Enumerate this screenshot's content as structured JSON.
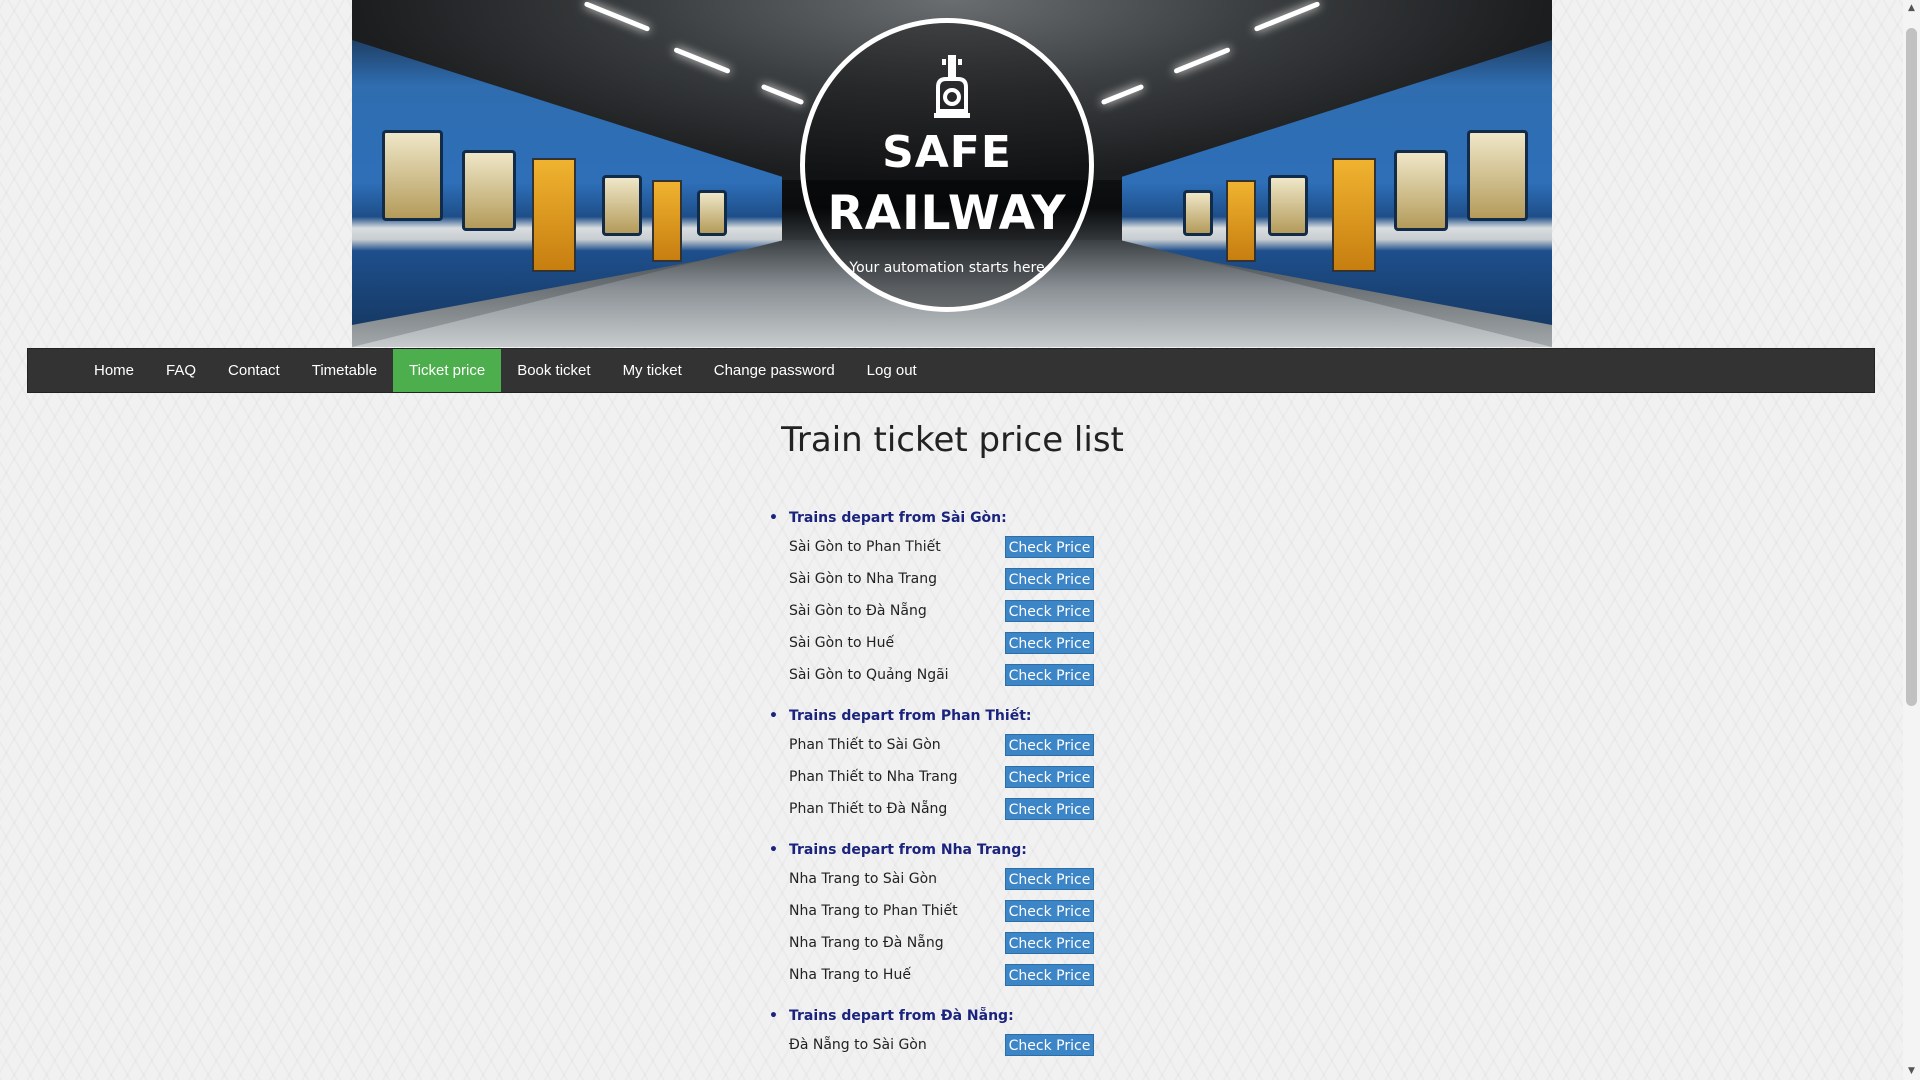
{
  "header": {
    "logo_line1": "SAFE",
    "logo_line2": "RAILWAY",
    "tagline": "Your automation starts here",
    "logo_icon": "train-icon"
  },
  "nav": {
    "items": [
      "Home",
      "FAQ",
      "Contact",
      "Timetable",
      "Ticket price",
      "Book ticket",
      "My ticket",
      "Change password",
      "Log out"
    ],
    "active": "Ticket price",
    "active_color": "#4cae4c",
    "background": "#333333"
  },
  "main": {
    "title": "Train ticket price list",
    "button_label": "Check Price",
    "button_color": "#3c85c7",
    "group_title_color": "#1a237e",
    "groups": [
      {
        "title": "Trains depart from Sài Gòn:",
        "routes": [
          "Sài Gòn to Phan Thiết",
          "Sài Gòn to Nha Trang",
          "Sài Gòn to Đà Nẵng",
          "Sài Gòn to Huế",
          "Sài Gòn to Quảng Ngãi"
        ]
      },
      {
        "title": "Trains depart from Phan Thiết:",
        "routes": [
          "Phan Thiết to Sài Gòn",
          "Phan Thiết to Nha Trang",
          "Phan Thiết to Đà Nẵng"
        ]
      },
      {
        "title": "Trains depart from Nha Trang:",
        "routes": [
          "Nha Trang to Sài Gòn",
          "Nha Trang to Phan Thiết",
          "Nha Trang to Đà Nẵng",
          "Nha Trang to Huế"
        ]
      },
      {
        "title": "Trains depart from Đà Nẵng:",
        "routes": [
          "Đà Nẵng to Sài Gòn"
        ]
      }
    ]
  }
}
